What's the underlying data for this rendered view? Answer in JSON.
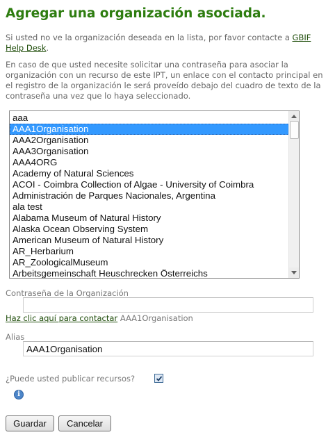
{
  "page": {
    "title": "Agregar una organización asociada.",
    "intro_text": "Si usted no ve la organización deseada en la lista, por favor contacte a",
    "intro_link": "GBIF Help Desk",
    "intro_end": ".",
    "password_info": "En caso de que usted necesite solicitar una contraseña para asociar la organización con un recurso de este IPT, un enlace con el contacto principal en el registro de la organización le será proveído debajo del cuadro de texto de la contraseña una vez que lo haya seleccionado."
  },
  "organizations": {
    "selected_index": 1,
    "items": [
      "aaa",
      "AAA1Organisation",
      "AAA2Organisation",
      "AAA3Organisation",
      "AAA4ORG",
      "Academy of Natural Sciences",
      "ACOI - Coimbra Collection of Algae - University of Coimbra",
      "Administración de Parques Nacionales, Argentina",
      "ala test",
      "Alabama Museum of Natural History",
      "Alaska Ocean Observing System",
      "American Museum of Natural History",
      "AR_Herbarium",
      "AR_ZoologicalMuseum",
      "Arbeitsgemeinschaft Heuschrecken Österreichs"
    ]
  },
  "form": {
    "password_label": "Contraseña de la Organización",
    "password_value": "",
    "contact_link": "Haz clic aquí para contactar",
    "contact_org": "AAA1Organisation",
    "alias_label": "Alias",
    "alias_value": "AAA1Organisation",
    "publish_label": "¿Puede usted publicar recursos?",
    "publish_checked": true
  },
  "buttons": {
    "save": "Guardar",
    "cancel": "Cancelar"
  },
  "icons": {
    "info": "info-icon",
    "checkmark": "checkmark-icon"
  },
  "colors": {
    "title": "#2e7d10",
    "link": "#1f4d0a",
    "selection": "#3399ff"
  }
}
